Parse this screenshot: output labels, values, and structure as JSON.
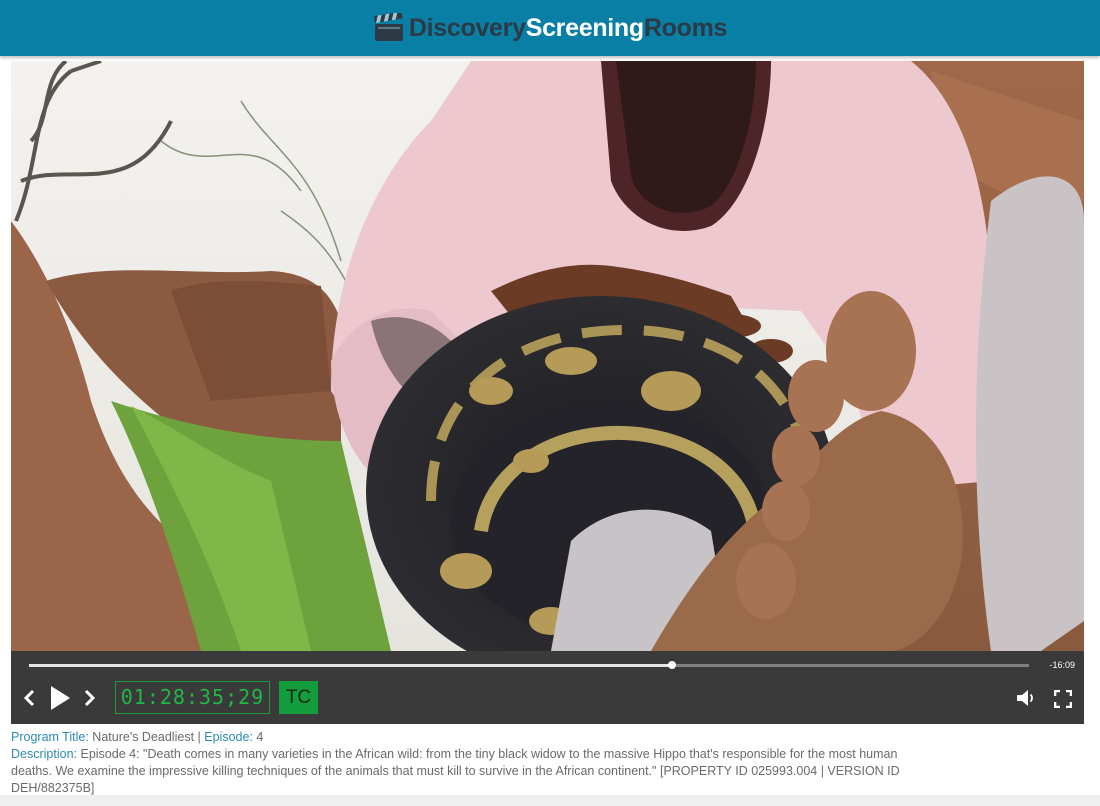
{
  "header": {
    "logo_part1": "Discovery",
    "logo_part2": "Screening",
    "logo_part3": "Rooms",
    "logo_icon": "clapperboard-icon",
    "colors": {
      "bar": "#0a7fa6",
      "dark_text": "#2b3a44",
      "light_text": "#ffffff"
    }
  },
  "player": {
    "progress": 0.643,
    "time_remaining": "-16:09",
    "timecode": "01:28:35;29",
    "tc_label": "TC",
    "icons": {
      "prev": "chevron-left-icon",
      "play": "play-icon",
      "next": "chevron-right-icon",
      "volume": "volume-icon",
      "fullscreen": "fullscreen-icon"
    },
    "colors": {
      "bar": "#3a3a3a",
      "timecode": "#1fb847",
      "tc_button": "#139c3c"
    }
  },
  "info": {
    "program_title_label": "Program Title:",
    "program_title": "Nature's Deadliest",
    "separator": "|",
    "episode_label": "Episode:",
    "episode": "4",
    "description_label": "Description:",
    "description": "Episode 4: \"Death comes in many varieties in the African wild: from the tiny black widow to the massive Hippo that's responsible for the most human deaths. We examine the impressive killing techniques of the animals that must kill to survive in the African continent.\" [PROPERTY ID 025993.004 | VERSION ID DEH/882375B]",
    "colors": {
      "label": "#2b8ab3",
      "text": "#6a6a6a"
    }
  }
}
